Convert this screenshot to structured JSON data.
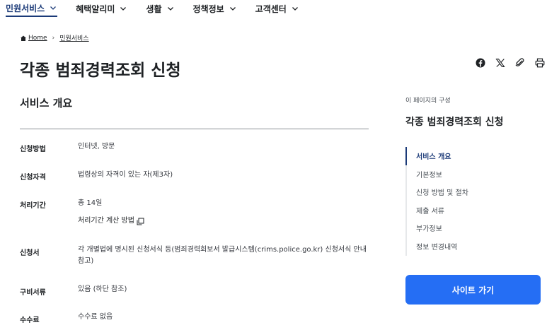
{
  "nav": {
    "items": [
      {
        "label": "민원서비스"
      },
      {
        "label": "혜택알리미"
      },
      {
        "label": "생활"
      },
      {
        "label": "정책정보"
      },
      {
        "label": "고객센터"
      }
    ]
  },
  "breadcrumb": {
    "home": "Home",
    "current": "민원서비스"
  },
  "page": {
    "title": "각종 범죄경력조회 신청"
  },
  "share": {
    "icons": [
      "facebook-icon",
      "x-icon",
      "link-icon",
      "print-icon"
    ]
  },
  "overview": {
    "title": "서비스 개요",
    "rows": [
      {
        "label": "신청방법",
        "value": "인터넷, 방문"
      },
      {
        "label": "신청자격",
        "value": "법령상의 자격이 있는 자(제3자)"
      },
      {
        "label": "처리기간",
        "value": "총 14일",
        "extra": "처리기간 계산 방법"
      },
      {
        "label": "신청서",
        "value": "각 개별법에 명시된 신청서식 등(범죄경력회보서 발급시스템(crims.police.go.kr) 신청서식 안내 참고)"
      },
      {
        "label": "구비서류",
        "value": "있음 (하단 참조)"
      },
      {
        "label": "수수료",
        "value": "수수료 없음"
      }
    ]
  },
  "toc": {
    "caption": "이 페이지의 구성",
    "title": "각종 범죄경력조회 신청",
    "items": [
      {
        "label": "서비스 개요"
      },
      {
        "label": "기본정보"
      },
      {
        "label": "신청 방법 및 절차"
      },
      {
        "label": "제출 서류"
      },
      {
        "label": "부가정보"
      },
      {
        "label": "정보 변경내역"
      }
    ]
  },
  "site_button": {
    "label": "사이트 가기"
  },
  "colors": {
    "accent": "#1b3a78",
    "primary_button": "#256ef4",
    "text": "#1e2124"
  }
}
